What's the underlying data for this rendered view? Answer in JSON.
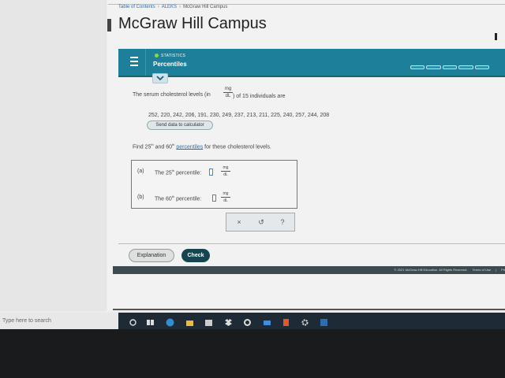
{
  "browser": {
    "breadcrumb": [
      {
        "label": "Table of Contents",
        "link": true
      },
      {
        "label": "ALEKS",
        "link": true
      },
      {
        "label": "McGraw Hill Campus",
        "link": false
      }
    ],
    "breadcrumb_sep": "›",
    "page_title": "McGraw Hill Campus"
  },
  "header": {
    "subject": "STATISTICS",
    "topic": "Percentiles",
    "colors": {
      "header": "#1d7f99",
      "status_dot": "#8bd44c"
    }
  },
  "question": {
    "intro_before": "The serum cholesterol levels (in",
    "intro_after": ") of 15 individuals are",
    "unit_num": "mg",
    "unit_den": "dL",
    "data_list": "252, 220, 242, 206, 191, 230, 249, 237, 213, 211, 225, 240, 257, 244, 208",
    "calc_button": "Send data to calculator",
    "find_before": "Find 25",
    "find_sup1": "th",
    "find_mid": " and 60",
    "find_sup2": "th",
    "find_link": "percentiles",
    "find_after": " for these cholesterol levels.",
    "parts": [
      {
        "label": "(a)",
        "text_before": "The 25",
        "sup": "th",
        "text_after": " percentile:",
        "value": "",
        "unit_num": "mg",
        "unit_den": "dL"
      },
      {
        "label": "(b)",
        "text_before": "The 60",
        "sup": "th",
        "text_after": " percentile:",
        "value": "",
        "unit_num": "mg",
        "unit_den": "dL"
      }
    ]
  },
  "tools": {
    "clear": "×",
    "undo": "↺",
    "help": "?"
  },
  "actions": {
    "explanation": "Explanation",
    "check": "Check"
  },
  "footer": {
    "copyright": "© 2021 McGraw-Hill Education. All Rights Reserved.",
    "terms": "Terms of Use",
    "sep": "|",
    "privacy": "Pri"
  },
  "taskbar": {
    "search_placeholder": "Type here to search",
    "icons": [
      "cortana-icon",
      "task-view-icon",
      "edge-icon",
      "file-explorer-icon",
      "store-icon",
      "dropbox-icon",
      "app-icon",
      "mail-icon",
      "office-icon",
      "settings-icon",
      "photos-icon"
    ]
  }
}
